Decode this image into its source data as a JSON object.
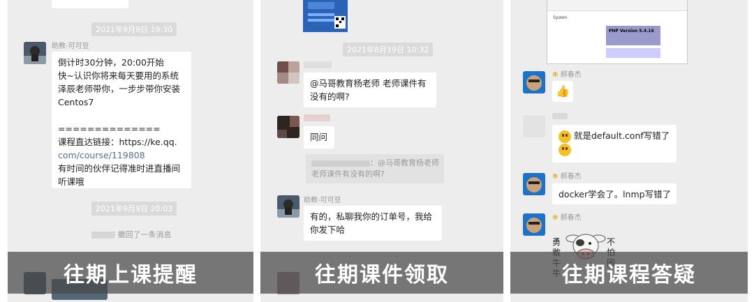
{
  "panels": [
    {
      "caption": "往期上课提醒",
      "timestamps": [
        "2021年9月9日 19:30",
        "2021年9月9日 20:03"
      ],
      "sender_name": "助教-可可豆",
      "message_lines": [
        "倒计时30分钟，20:00开始",
        "快~认识你将来每天要用的系统",
        "泽辰老师带你，一步步带你安装",
        "Centos7",
        "",
        "==============",
        "课程直达链接：https://ke.qq.",
        "com/course/119808",
        "有时间的伙伴记得准时进直播间",
        "听课哦"
      ],
      "recall_notice": "撤回了一条消息"
    },
    {
      "caption": "往期课件领取",
      "timestamp": "2021年8月19日 10:32",
      "question_lines": [
        "@马哥教育杨老师 老师课件有",
        "没有的啊?"
      ],
      "ask": "同问",
      "quote_lines": [
        "：@马哥教育杨老师",
        "老师课件有没有的啊?"
      ],
      "reply_sender": "助教-可可豆",
      "reply_lines": [
        "有的，私聊我你的订单号，我给",
        "你发下哈"
      ]
    },
    {
      "caption": "往期课程答疑",
      "php_title": "PHP Version 5.4.16",
      "php_label": "System",
      "sender_name": "郝春杰",
      "msg_default": "就是default.conf写错了",
      "msg_docker": "docker学会了。lnmp写错了",
      "sticker_left": [
        "勇",
        "敢",
        "牛",
        "牛"
      ],
      "sticker_right": [
        "不",
        "怕",
        "困"
      ],
      "colors": {
        "bubble_green": "#95ec69",
        "link": "#576b95",
        "overlay": "rgba(72,72,72,0.72)"
      }
    }
  ]
}
